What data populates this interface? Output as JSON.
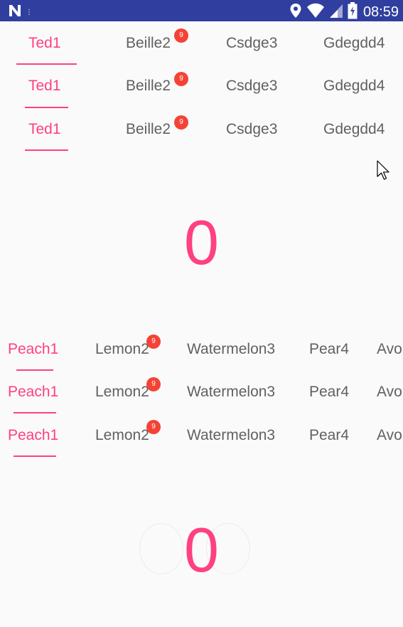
{
  "status_bar": {
    "time": "08:59",
    "app_icon": "n-notification-icon",
    "icons": [
      "location-icon",
      "wifi-icon",
      "cell-signal-icon",
      "battery-icon"
    ]
  },
  "top_tabs": {
    "labels": [
      "Ted1",
      "Beille2",
      "Csdge3",
      "Gdegdd4"
    ],
    "badge": "9",
    "selected": "Ted1"
  },
  "top_counter": "0",
  "bottom_tabs": {
    "labels": [
      "Peach1",
      "Lemon2",
      "Watermelon3",
      "Pear4",
      "Avo"
    ],
    "badge": "9",
    "selected": "Peach1"
  },
  "bottom_counter": "0",
  "colors": {
    "status_bar": "#303f9f",
    "accent": "#ff4081",
    "badge": "#f44336",
    "tab_text": "#616161",
    "background": "#fafafa"
  }
}
